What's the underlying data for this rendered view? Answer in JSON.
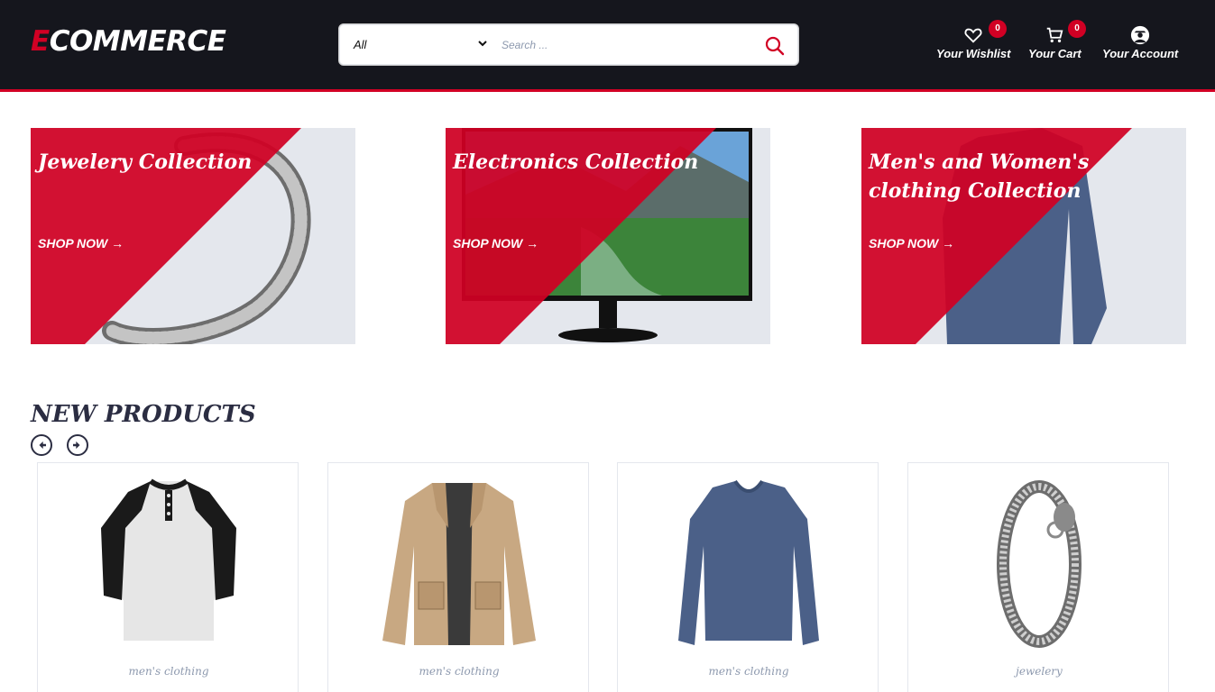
{
  "header": {
    "logo_first": "E",
    "logo_rest": "COMMERCE",
    "search": {
      "category": "All",
      "placeholder": "Search ..."
    },
    "wishlist": {
      "label": "Your Wishlist",
      "count": "0",
      "icon": "heart-icon"
    },
    "cart": {
      "label": "Your Cart",
      "count": "0",
      "icon": "cart-icon"
    },
    "account": {
      "label": "Your Account",
      "icon": "user-icon"
    }
  },
  "collections": [
    {
      "title": "Jewelery Collection",
      "cta": "SHOP NOW →"
    },
    {
      "title": "Electronics Collection",
      "cta": "SHOP NOW →"
    },
    {
      "title": "Men's and Women's clothing Collection",
      "cta": "SHOP NOW →"
    }
  ],
  "new_products": {
    "title": "NEW PRODUCTS",
    "items": [
      {
        "category": "men's clothing"
      },
      {
        "category": "men's clothing"
      },
      {
        "category": "men's clothing"
      },
      {
        "category": "jewelery"
      }
    ]
  },
  "colors": {
    "primary": "#d10024",
    "header_bg": "#15161d",
    "text": "#2b2d42",
    "muted": "#8d99ae",
    "panel": "#e4e7ed"
  }
}
